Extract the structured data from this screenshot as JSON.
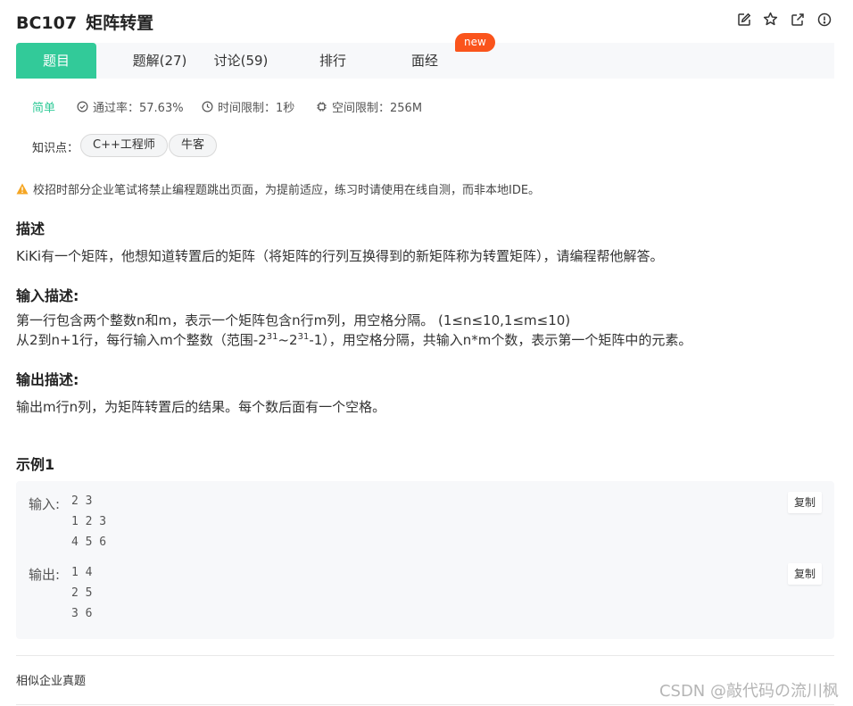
{
  "header": {
    "problem_id": "BC107",
    "problem_title": "矩阵转置",
    "icons": [
      "edit-icon",
      "star-icon",
      "external-link-icon",
      "report-icon"
    ]
  },
  "tabs": [
    {
      "label": "题目",
      "active": true
    },
    {
      "label": "题解(27)",
      "active": false
    },
    {
      "label": "讨论(59)",
      "active": false
    },
    {
      "label": "排行",
      "active": false
    },
    {
      "label": "面经",
      "active": false
    }
  ],
  "new_badge": "new",
  "meta": {
    "difficulty": "简单",
    "pass_rate": "通过率：57.63%",
    "time_limit": "时间限制：1秒",
    "memory_limit": "空间限制：256M"
  },
  "knowledge": {
    "label": "知识点：",
    "tags": [
      "C++工程师",
      "牛客"
    ]
  },
  "warning": "校招时部分企业笔试将禁止编程题跳出页面，为提前适应，练习时请使用在线自测，而非本地IDE。",
  "description": {
    "heading": "描述",
    "text": "KiKi有一个矩阵，他想知道转置后的矩阵（将矩阵的行列互换得到的新矩阵称为转置矩阵），请编程帮他解答。"
  },
  "input_desc": {
    "heading": "输入描述:",
    "line1": "第一行包含两个整数n和m，表示一个矩阵包含n行m列，用空格分隔。 (1≤n≤10,1≤m≤10)",
    "line2_a": "从2到n+1行，每行输入m个整数（范围-2",
    "line2_sup1": "31",
    "line2_b": "~2",
    "line2_sup2": "31",
    "line2_c": "-1），用空格分隔，共输入n*m个数，表示第一个矩阵中的元素。"
  },
  "output_desc": {
    "heading": "输出描述:",
    "text": "输出m行n列，为矩阵转置后的结果。每个数后面有一个空格。"
  },
  "example": {
    "heading": "示例1",
    "input_label": "输入:",
    "input_value": "2 3\n1 2 3\n4 5 6",
    "output_label": "输出:",
    "output_value": "1 4\n2 5\n3 6",
    "copy_label": "复制"
  },
  "similar_link": "相似企业真题",
  "watermark": "CSDN @敲代码の流川枫"
}
